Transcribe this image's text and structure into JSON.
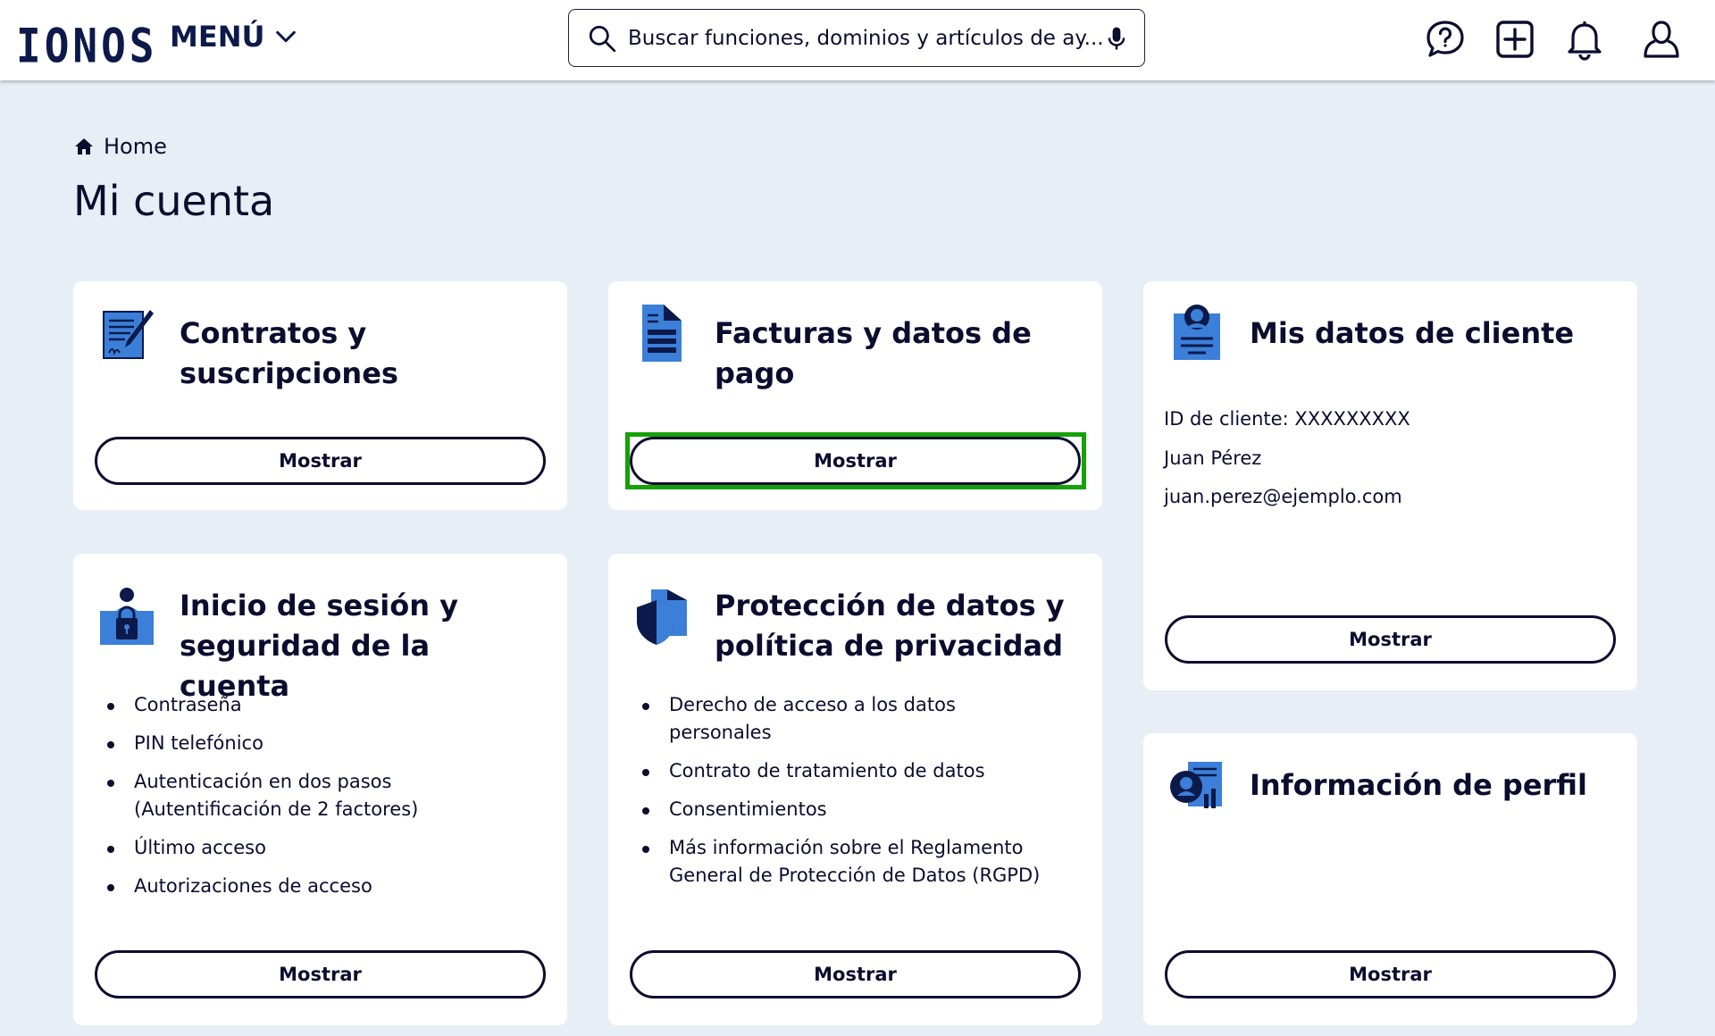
{
  "header": {
    "logo": "IONOS",
    "menu_label": "MENÚ",
    "search_placeholder": "Buscar funciones, dominios y artículos de ay..."
  },
  "breadcrumb": {
    "home": "Home"
  },
  "page_title": "Mi cuenta",
  "cards": {
    "contratos": {
      "title": "Contratos y suscripciones",
      "button": "Mostrar",
      "icon": "contract-icon"
    },
    "facturas": {
      "title": "Facturas y datos de pago",
      "button": "Mostrar",
      "icon": "invoice-icon"
    },
    "cliente": {
      "title": "Mis datos de cliente",
      "lines": [
        "ID de cliente: XXXXXXXXX",
        "Juan Pérez",
        "juan.perez@ejemplo.com"
      ],
      "button": "Mostrar",
      "icon": "customer-id-icon"
    },
    "seguridad": {
      "title": "Inicio de sesión y seguridad de la cuenta",
      "items": [
        "Contraseña",
        "PIN telefónico",
        "Autenticación en dos pasos (Autentificación de 2 factores)",
        "Último acceso",
        "Autorizaciones de acceso"
      ],
      "button": "Mostrar",
      "icon": "security-lock-icon"
    },
    "proteccion": {
      "title": "Protección de datos y política de privacidad",
      "items": [
        "Derecho de acceso a los datos personales",
        "Contrato de tratamiento de datos",
        "Consentimientos",
        "Más información sobre el Reglamento General de Protección de Datos (RGPD)"
      ],
      "button": "Mostrar",
      "icon": "shield-document-icon"
    },
    "perfil": {
      "title": "Información de perfil",
      "button": "Mostrar",
      "icon": "profile-info-icon"
    }
  },
  "colors": {
    "background": "#e8eef5",
    "navy": "#0b1a4a",
    "icon_blue": "#3b7fd9",
    "focus_green": "#16a00a"
  }
}
